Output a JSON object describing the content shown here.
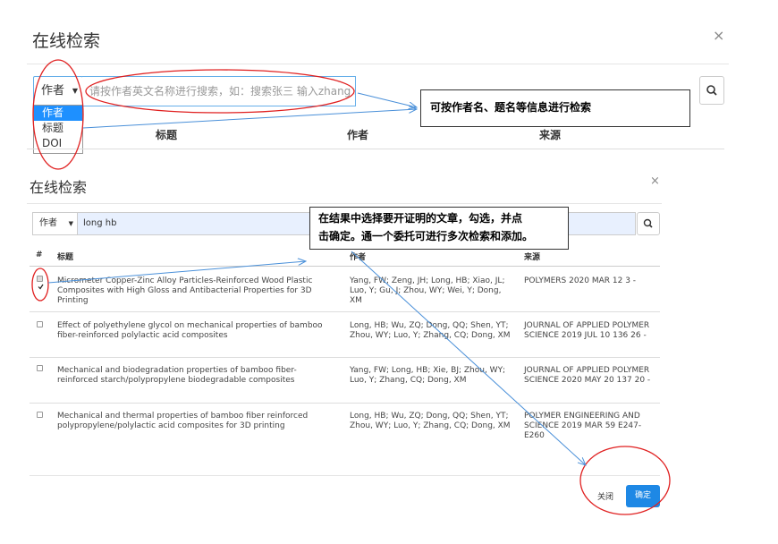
{
  "dialog1": {
    "title": "在线检索",
    "close_label": "×",
    "select_value": "作者",
    "search_placeholder": "请按作者英文名称进行搜索，如：搜索张三 输入zhang s",
    "dropdown_options": [
      "作者",
      "标题",
      "DOI"
    ],
    "columns": [
      "标题",
      "作者",
      "来源"
    ],
    "callout": "可按作者名、题名等信息进行检索"
  },
  "dialog2": {
    "title": "在线检索",
    "close_label": "×",
    "select_value": "作者",
    "search_value": "long hb",
    "callout_line1": "在结果中选择要开证明的文章，勾选，并点",
    "callout_line2": "击确定。通一个委托可进行多次检索和添加。",
    "columns": [
      "#",
      "标题",
      "作者",
      "来源"
    ],
    "rows": [
      {
        "checked": true,
        "title": "Micrometer Copper-Zinc Alloy Particles-Reinforced Wood Plastic Composites with High Gloss and Antibacterial Properties for 3D Printing",
        "authors": "Yang, FW; Zeng, JH; Long, HB; Xiao, JL; Luo, Y; Gu, J; Zhou, WY; Wei, Y; Dong, XM",
        "source": "POLYMERS 2020 MAR 12 3 -"
      },
      {
        "checked": false,
        "title": "Effect of polyethylene glycol on mechanical properties of bamboo fiber-reinforced polylactic acid composites",
        "authors": "Long, HB; Wu, ZQ; Dong, QQ; Shen, YT; Zhou, WY; Luo, Y; Zhang, CQ; Dong, XM",
        "source": "JOURNAL OF APPLIED POLYMER SCIENCE 2019 JUL 10 136 26 -"
      },
      {
        "checked": false,
        "title": "Mechanical and biodegradation properties of bamboo fiber-reinforced starch/polypropylene biodegradable composites",
        "authors": "Yang, FW; Long, HB; Xie, BJ; Zhou, WY; Luo, Y; Zhang, CQ; Dong, XM",
        "source": "JOURNAL OF APPLIED POLYMER SCIENCE 2020 MAY 20 137 20 -"
      },
      {
        "checked": false,
        "title": "Mechanical and thermal properties of bamboo fiber reinforced polypropylene/polylactic acid composites for 3D printing",
        "authors": "Long, HB; Wu, ZQ; Dong, QQ; Shen, YT; Zhou, WY; Luo, Y; Zhang, CQ; Dong, XM",
        "source": "POLYMER ENGINEERING AND SCIENCE 2019 MAR 59 E247-E260"
      }
    ],
    "close_button": "关闭",
    "ok_button": "确定"
  },
  "colors": {
    "primary": "#1e88e5",
    "annotation_red": "#e02020",
    "arrow_blue": "#4a90d9",
    "input_focus": "#66afe9"
  },
  "icons": [
    "search-icon",
    "close-icon",
    "caret-down-icon",
    "checkbox-icon"
  ]
}
